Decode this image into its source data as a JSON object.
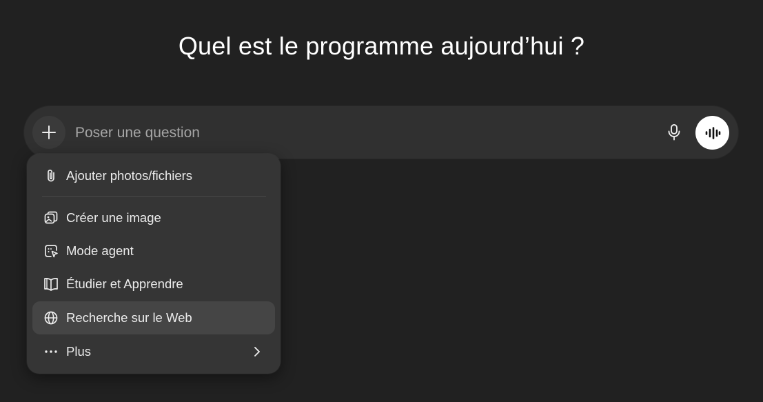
{
  "heading": "Quel est le programme aujourd’hui ?",
  "composer": {
    "placeholder": "Poser une question",
    "value": "",
    "icons": {
      "add": "plus-icon",
      "dictate": "microphone-icon",
      "voice": "voice-waveform-icon"
    }
  },
  "menu": {
    "items": [
      {
        "label": "Ajouter photos/fichiers",
        "icon": "paperclip-icon"
      },
      {
        "label": "Créer une image",
        "icon": "image-create-icon"
      },
      {
        "label": "Mode agent",
        "icon": "agent-cursor-icon"
      },
      {
        "label": "Étudier et Apprendre",
        "icon": "book-open-icon"
      },
      {
        "label": "Recherche sur le Web",
        "icon": "globe-icon",
        "highlighted": true
      },
      {
        "label": "Plus",
        "icon": "more-dots-icon",
        "trailing_icon": "chevron-right-icon"
      }
    ]
  },
  "colors": {
    "background": "#212121",
    "composer": "#303030",
    "menu": "#353535",
    "menu_highlight": "#454545",
    "text": "#ececec",
    "placeholder": "#a5a5a5"
  }
}
